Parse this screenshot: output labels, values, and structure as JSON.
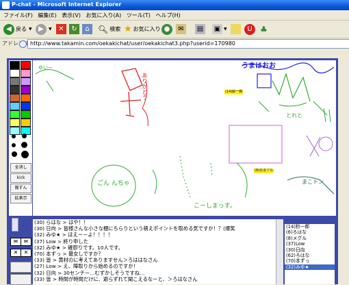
{
  "window": {
    "title": "P-chat - Microsoft Internet Explorer"
  },
  "menu": [
    "ファイル(F)",
    "編集(E)",
    "表示(V)",
    "お気に入り(A)",
    "ツール(T)",
    "ヘルプ(H)"
  ],
  "toolbar": {
    "back_label": "戻る",
    "search_label": "検索",
    "favorites_label": "お気に入り"
  },
  "address": {
    "label": "アドレス(D)",
    "url": "http://www.takamin.com/oekakichat/user/oekakichat3.php?userid=170980"
  },
  "tools": {
    "clear_all": "全消し",
    "kick": "kick",
    "hide": "隠ずん",
    "show": "拡表示"
  },
  "canvas": {
    "tags": [
      "(14)鈴一郎",
      "(8)のるゾル"
    ],
    "scribble_texts": [
      "うまはおお",
      "ゆいー",
      "ありがとう",
      "とれと",
      "まこトン",
      "ごん んちゃ",
      "こーしまっす。"
    ]
  },
  "chat": {
    "lines": [
      "(30) らはな > はや！！",
      "(30) 日向 > 皆様さんな小さな棚にちらりという萌えポイントを取める気ですか！？(爆笑",
      "(32) みゆ★ > ほえー－よ！！！！",
      "(37) Low > 終り申した",
      "(32) みゆ★ > 確即りです。10人です。",
      "(70) 本ずっ > 最女しですか？",
      "(33) 皆 > 黄材のに考えてありますせん＞ろははなさん",
      "(27) Low > え、陣取りから始めるのですか！",
      "(32) 日向 > 30センチー…むずかしそうですね…",
      "(33) 皆 > 時間が時間だけに、避らずれて聞こえるなーと、＞ろはなさん"
    ]
  },
  "users": [
    "(14)鈴一郎",
    "(6)ろはな",
    "(8)メグル",
    "(37)Low",
    "(30)日向",
    "(62)ろはな",
    "(70)本ずっ",
    "(32)みゆ★"
  ],
  "colors": {
    "applet_bg": "#3c4aa8",
    "palette": [
      "#000000",
      "#ff0000",
      "#ffffff",
      "#ff99cc",
      "#777777",
      "#cc99ff",
      "#333333",
      "#9900cc",
      "#cc6633",
      "#ff6600",
      "#66ccff",
      "#0033ff",
      "#33ff33",
      "#00cc00",
      "#ffff66",
      "#ffcc00",
      "#99ffff",
      "#00ffff"
    ],
    "username_highlight": "#3c6ac8",
    "tag_bg": "#ffee22"
  }
}
